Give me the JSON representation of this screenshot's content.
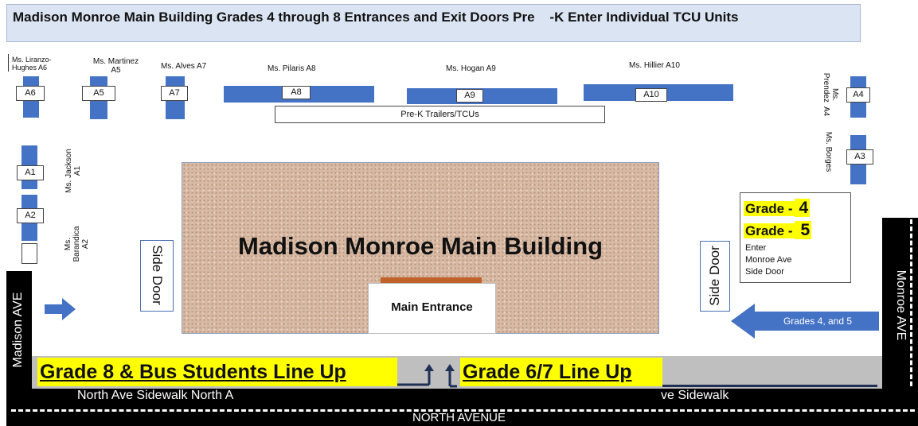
{
  "title": "Madison Monroe Main Building Grades 4 through 8 Entrances and Exit Doors Pre    -K Enter Individual TCU Units",
  "units": {
    "A1": "A1",
    "A2": "A2",
    "A3": "A3",
    "A4": "A4",
    "A5": "A5",
    "A6": "A6",
    "A7": "A7",
    "A8": "A8",
    "A9": "A9",
    "A10": "A10"
  },
  "teachers": {
    "a6": "Ms. Liranzo-\nHughes A6",
    "a5": "Ms. Martinez\nA5",
    "a7": "Ms. Alves A7",
    "a8": "Ms. Pilaris A8",
    "a9": "Ms. Hogan A9",
    "a10": "Ms. Hillier A10",
    "a4": "Ms.\nPrendez  A4",
    "a3": "Ms. Borges",
    "a1": "Ms. Jackson\nA1",
    "a2": "Ms.\nBarandica\nA2"
  },
  "prek_trailers": "Pre-K Trailers/TCUs",
  "main_building": "Madison Monroe Main Building",
  "main_entrance": "Main Entrance",
  "side_door_left": "Side Door",
  "side_door_right": "Side Door",
  "grade_panel": {
    "grade4_word": "Grade  -",
    "grade4_num": "4",
    "grade5_word": "Grade -",
    "grade5_num": "5",
    "line1": "Enter",
    "line2": "Monroe Ave",
    "line3": "Side Door"
  },
  "grades_arrow_label": "Grades 4, and 5",
  "lineup_left": "Grade 8 & Bus Students  Line Up",
  "lineup_right": "Grade 6/7 Line Up",
  "sidewalk_left": "North Ave Sidewalk North A",
  "sidewalk_right": "ve Sidewalk",
  "north_avenue": "NORTH AVENUE",
  "madison_ave": "Madison AVE",
  "monroe_ave": "Monroe AVE",
  "colors": {
    "unit_blue": "#4472c4",
    "highlight": "#ffff00",
    "title_bg": "#dbe4f3",
    "entrance_brown": "#c0622a"
  }
}
